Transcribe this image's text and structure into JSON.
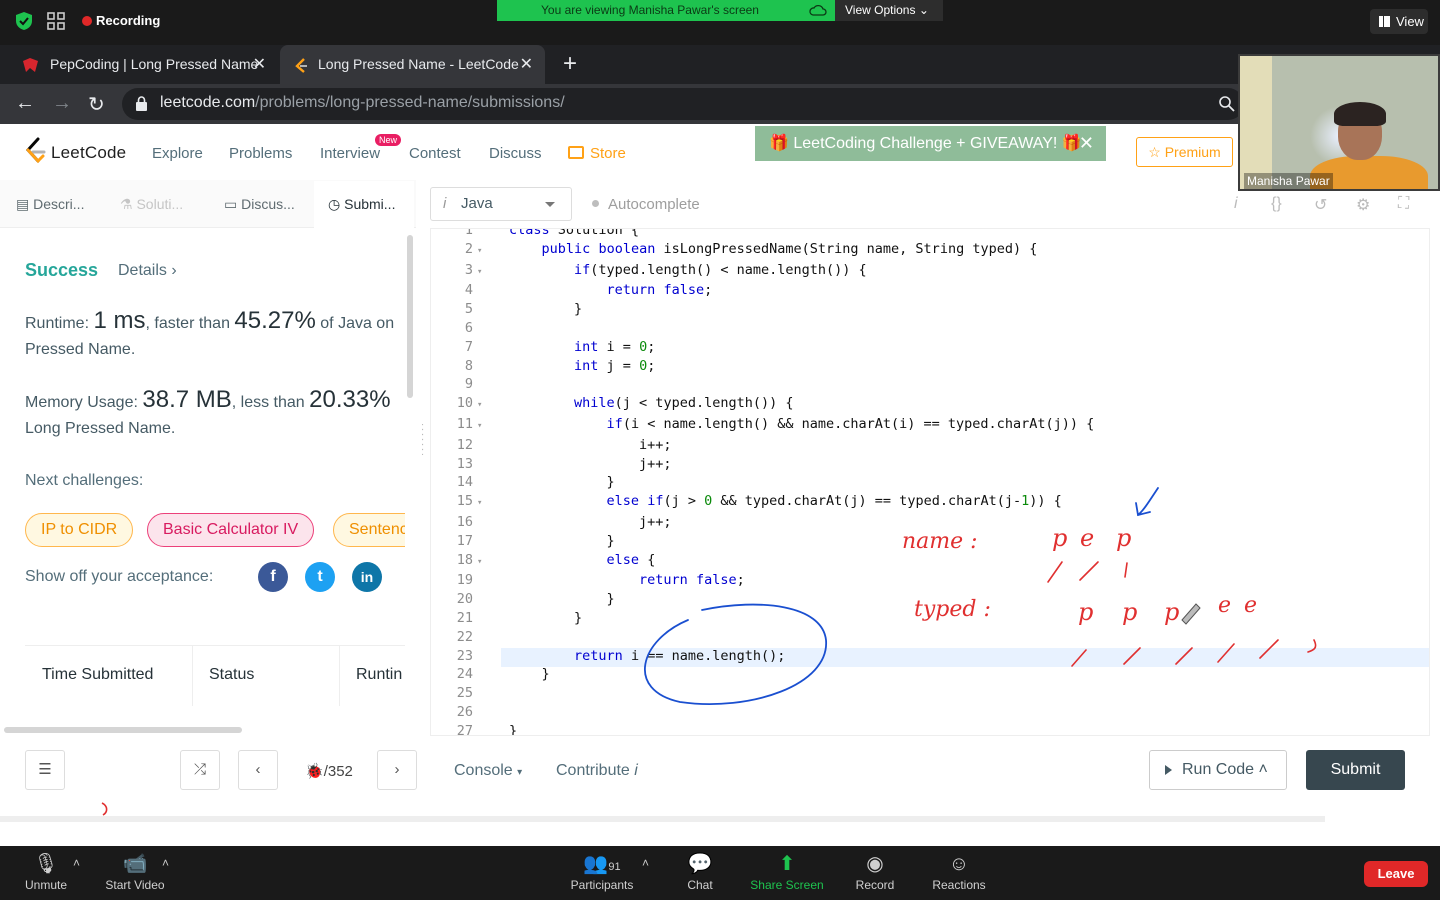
{
  "zoom": {
    "recording_label": "Recording",
    "viewing_banner": "You are viewing Manisha Pawar's screen",
    "view_options": "View Options",
    "view_button": "View",
    "presenter_name": "Manisha Pawar",
    "toolbar": [
      {
        "label": "Unmute",
        "icon": "mic-muted-icon"
      },
      {
        "label": "Start Video",
        "icon": "video-off-icon"
      },
      {
        "label": "Participants",
        "icon": "participants-icon",
        "count": "91"
      },
      {
        "label": "Chat",
        "icon": "chat-icon"
      },
      {
        "label": "Share Screen",
        "icon": "share-screen-icon"
      },
      {
        "label": "Record",
        "icon": "record-icon"
      },
      {
        "label": "Reactions",
        "icon": "reactions-icon"
      }
    ],
    "leave_label": "Leave",
    "share_color": "#1ec34f",
    "leave_color": "#e02828"
  },
  "browser": {
    "tabs": [
      {
        "title": "PepCoding | Long Pressed Name"
      },
      {
        "title": "Long Pressed Name - LeetCode"
      }
    ],
    "url_domain": "leetcode.com",
    "url_path": "/problems/long-pressed-name/submissions/"
  },
  "leetcode": {
    "brand": "LeetCode",
    "nav": [
      "Explore",
      "Problems",
      "Interview",
      "Contest",
      "Discuss"
    ],
    "new_badge": "New",
    "store": "Store",
    "challenge_banner": "🎁 LeetCoding Challenge + GIVEAWAY! 🎁",
    "premium": "☆ Premium",
    "accent": "#ffa116",
    "left_tabs": [
      "Descri...",
      "Soluti...",
      "Discus...",
      "Submi..."
    ],
    "result": {
      "status": "Success",
      "details": "Details",
      "runtime_prefix": "Runtime: ",
      "runtime_value": "1 ms",
      "runtime_mid": ", faster than ",
      "runtime_pct": "45.27%",
      "runtime_suffix": " of Java on",
      "runtime_line2": "Pressed Name.",
      "memory_prefix": "Memory Usage: ",
      "memory_value": "38.7 MB",
      "memory_mid": ", less than ",
      "memory_pct": "20.33%",
      "memory_suffix": " ",
      "memory_line2": "Long Pressed Name.",
      "success_color": "#26a69a"
    },
    "next_challenges_label": "Next challenges:",
    "challenges": [
      "IP to CIDR",
      "Basic Calculator IV",
      "Sentenc"
    ],
    "show_off_label": "Show off your acceptance:",
    "share_icons": [
      "facebook-icon",
      "twitter-icon",
      "linkedin-icon"
    ],
    "table_headers": [
      "Time Submitted",
      "Status",
      "Runtin"
    ],
    "language": "Java",
    "autocomplete": "Autocomplete",
    "page_counter": "/352",
    "console": "Console",
    "contribute": "Contribute",
    "run_code": "Run Code",
    "submit": "Submit"
  },
  "code_lines": [
    {
      "n": "1",
      "fold": "",
      "html": "class Solution {"
    },
    {
      "n": "2",
      "fold": "▾",
      "html": "    public boolean isLongPressedName(String name, String typed) {"
    },
    {
      "n": "3",
      "fold": "▾",
      "html": "        if(typed.length() < name.length()) {"
    },
    {
      "n": "4",
      "fold": "",
      "html": "            return false;"
    },
    {
      "n": "5",
      "fold": "",
      "html": "        }"
    },
    {
      "n": "6",
      "fold": "",
      "html": ""
    },
    {
      "n": "7",
      "fold": "",
      "html": "        int i = 0;"
    },
    {
      "n": "8",
      "fold": "",
      "html": "        int j = 0;"
    },
    {
      "n": "9",
      "fold": "",
      "html": ""
    },
    {
      "n": "10",
      "fold": "▾",
      "html": "        while(j < typed.length()) {"
    },
    {
      "n": "11",
      "fold": "▾",
      "html": "            if(i < name.length() && name.charAt(i) == typed.charAt(j)) {"
    },
    {
      "n": "12",
      "fold": "",
      "html": "                i++;"
    },
    {
      "n": "13",
      "fold": "",
      "html": "                j++;"
    },
    {
      "n": "14",
      "fold": "",
      "html": "            }"
    },
    {
      "n": "15",
      "fold": "▾",
      "html": "            else if(j > 0 && typed.charAt(j) == typed.charAt(j-1)) {"
    },
    {
      "n": "16",
      "fold": "",
      "html": "                j++;"
    },
    {
      "n": "17",
      "fold": "",
      "html": "            }"
    },
    {
      "n": "18",
      "fold": "▾",
      "html": "            else {"
    },
    {
      "n": "19",
      "fold": "",
      "html": "                return false;"
    },
    {
      "n": "20",
      "fold": "",
      "html": "            }"
    },
    {
      "n": "21",
      "fold": "",
      "html": "        }"
    },
    {
      "n": "22",
      "fold": "",
      "html": ""
    },
    {
      "n": "23",
      "fold": "",
      "html": "        return i == name.length();"
    },
    {
      "n": "24",
      "fold": "",
      "html": "    }"
    },
    {
      "n": "25",
      "fold": "",
      "html": ""
    },
    {
      "n": "26",
      "fold": "",
      "html": ""
    },
    {
      "n": "27",
      "fold": "",
      "html": "}"
    }
  ],
  "annotations": {
    "name_label": "name :",
    "typed_label": "typed :",
    "name_chars": [
      "p",
      "e",
      "p"
    ],
    "typed_chars": [
      "p",
      "p",
      "p",
      "e",
      "e"
    ],
    "ink_color": "#e03030",
    "pen_color": "#1a4fd0"
  }
}
